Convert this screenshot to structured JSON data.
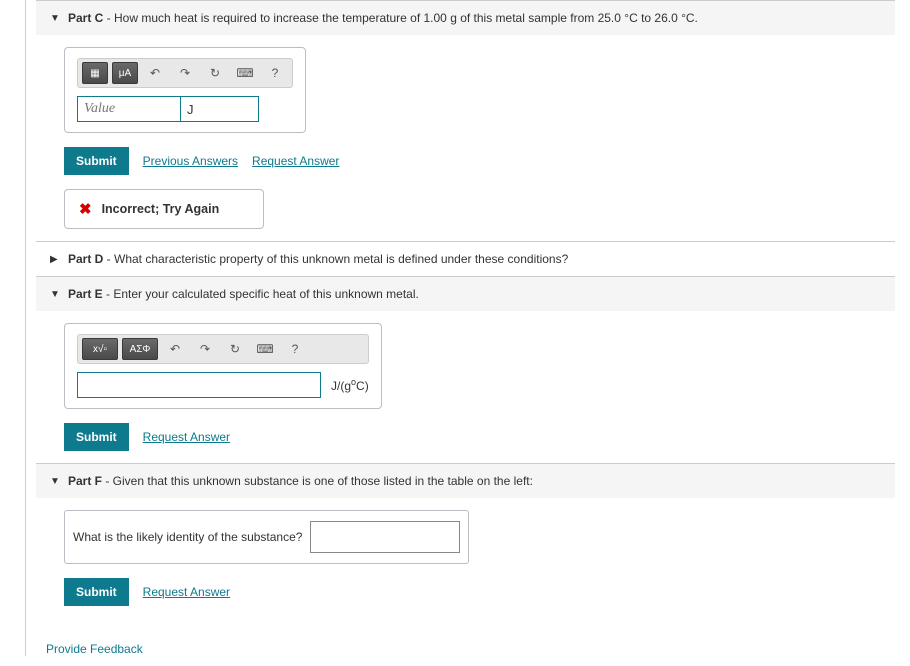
{
  "partC": {
    "title": "Part C",
    "desc": " - How much heat is required to increase the temperature of 1.00 g of this metal sample from 25.0 °C to 26.0 °C.",
    "toolbar": {
      "b1": "▦",
      "b2": "μA",
      "undo": "↶",
      "redo": "↷",
      "reset": "↻",
      "kbd": "⌨",
      "help": "?"
    },
    "value_placeholder": "Value",
    "unit_value": "J",
    "submit": "Submit",
    "prev": "Previous Answers",
    "req": "Request Answer",
    "feedback": "Incorrect; Try Again"
  },
  "partD": {
    "title": "Part D",
    "desc": " - What characteristic property of this unknown metal is defined under these conditions?"
  },
  "partE": {
    "title": "Part E",
    "desc": " - Enter your calculated specific heat of this unknown metal.",
    "toolbar": {
      "b1": "x√▫",
      "b2": "ΑΣΦ",
      "undo": "↶",
      "redo": "↷",
      "reset": "↻",
      "kbd": "⌨",
      "help": "?"
    },
    "units_html": "J/(g°C)",
    "submit": "Submit",
    "req": "Request Answer"
  },
  "partF": {
    "title": "Part F",
    "desc": " - Given that this unknown substance is one of those listed in the table on the left:",
    "label": "What is the likely identity of the substance?",
    "submit": "Submit",
    "req": "Request Answer"
  },
  "footer": {
    "feedback": "Provide Feedback"
  }
}
